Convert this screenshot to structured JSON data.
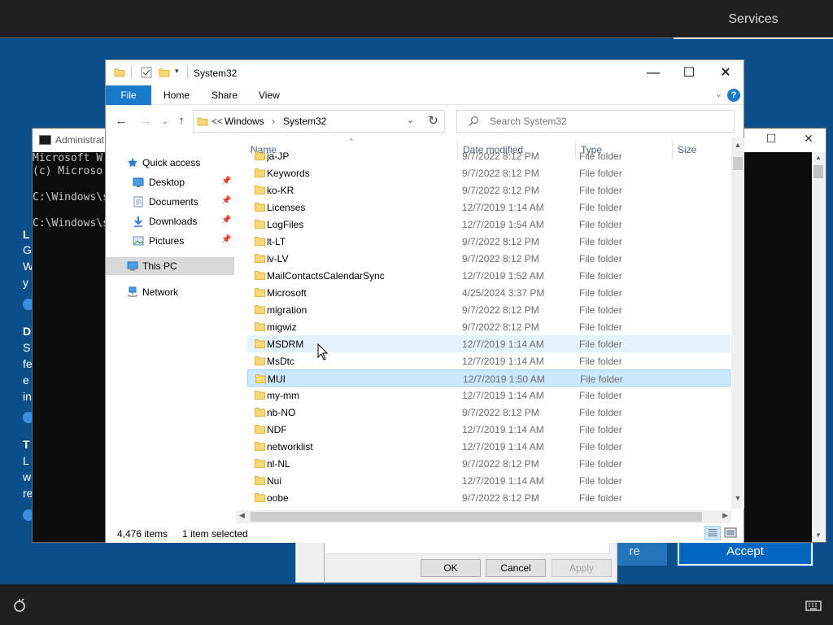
{
  "oobe": {
    "top_right_label": "Services",
    "side_letters": [
      "L",
      "G",
      "W",
      "y",
      "D",
      "S",
      "fe",
      "e",
      "in",
      "T",
      "L",
      "w",
      "re"
    ],
    "accept_label": "Accept",
    "more_label": "re"
  },
  "cmd": {
    "title": "Administrat",
    "lines": [
      "Microsoft W",
      "(c) Microso",
      "",
      "C:\\Windows\\s",
      "",
      "C:\\Windows\\s"
    ]
  },
  "props_dialog": {
    "ok_label": "OK",
    "cancel_label": "Cancel",
    "apply_label": "Apply"
  },
  "explorer": {
    "title": "System32",
    "ribbon_tabs": [
      "File",
      "Home",
      "Share",
      "View"
    ],
    "help_label": "?",
    "address": {
      "overflow": "<<",
      "crumbs": [
        "Windows",
        "System32"
      ]
    },
    "search_placeholder": "Search System32",
    "nav_pane": [
      {
        "label": "Quick access",
        "icon": "star-icon"
      },
      {
        "label": "Desktop",
        "icon": "desktop-icon",
        "pinned": true
      },
      {
        "label": "Documents",
        "icon": "documents-icon",
        "pinned": true
      },
      {
        "label": "Downloads",
        "icon": "downloads-icon",
        "pinned": true
      },
      {
        "label": "Pictures",
        "icon": "pictures-icon",
        "pinned": true
      },
      {
        "label": "This PC",
        "icon": "computer-icon",
        "selected": true
      },
      {
        "label": "Network",
        "icon": "network-icon"
      }
    ],
    "columns": [
      "Name",
      "Date modified",
      "Type",
      "Size"
    ],
    "rows": [
      {
        "name": "ja-JP",
        "date": "9/7/2022 8:12 PM",
        "type": "File folder"
      },
      {
        "name": "Keywords",
        "date": "9/7/2022 8:12 PM",
        "type": "File folder"
      },
      {
        "name": "ko-KR",
        "date": "9/7/2022 8:12 PM",
        "type": "File folder"
      },
      {
        "name": "Licenses",
        "date": "12/7/2019 1:14 AM",
        "type": "File folder"
      },
      {
        "name": "LogFiles",
        "date": "12/7/2019 1:54 AM",
        "type": "File folder"
      },
      {
        "name": "lt-LT",
        "date": "9/7/2022 8:12 PM",
        "type": "File folder"
      },
      {
        "name": "lv-LV",
        "date": "9/7/2022 8:12 PM",
        "type": "File folder"
      },
      {
        "name": "MailContactsCalendarSync",
        "date": "12/7/2019 1:52 AM",
        "type": "File folder"
      },
      {
        "name": "Microsoft",
        "date": "4/25/2024 3:37 PM",
        "type": "File folder"
      },
      {
        "name": "migration",
        "date": "9/7/2022 8:12 PM",
        "type": "File folder"
      },
      {
        "name": "migwiz",
        "date": "9/7/2022 8:12 PM",
        "type": "File folder"
      },
      {
        "name": "MSDRM",
        "date": "12/7/2019 1:14 AM",
        "type": "File folder",
        "state": "hover"
      },
      {
        "name": "MsDtc",
        "date": "12/7/2019 1:14 AM",
        "type": "File folder"
      },
      {
        "name": "MUI",
        "date": "12/7/2019 1:50 AM",
        "type": "File folder",
        "state": "selected"
      },
      {
        "name": "my-mm",
        "date": "12/7/2019 1:14 AM",
        "type": "File folder"
      },
      {
        "name": "nb-NO",
        "date": "9/7/2022 8:12 PM",
        "type": "File folder"
      },
      {
        "name": "NDF",
        "date": "12/7/2019 1:14 AM",
        "type": "File folder"
      },
      {
        "name": "networklist",
        "date": "12/7/2019 1:14 AM",
        "type": "File folder"
      },
      {
        "name": "nl-NL",
        "date": "9/7/2022 8:12 PM",
        "type": "File folder"
      },
      {
        "name": "Nui",
        "date": "12/7/2019 1:14 AM",
        "type": "File folder"
      },
      {
        "name": "oobe",
        "date": "9/7/2022 8:12 PM",
        "type": "File folder"
      }
    ],
    "status": {
      "item_count": "4,476 items",
      "selection": "1 item selected"
    }
  },
  "colors": {
    "oobe_blue": "#0a4f8a",
    "file_tab": "#1979ca",
    "selected_row": "#cce8ff",
    "hover_row": "#e5f3ff",
    "folder_yellow": "#f8d775"
  }
}
